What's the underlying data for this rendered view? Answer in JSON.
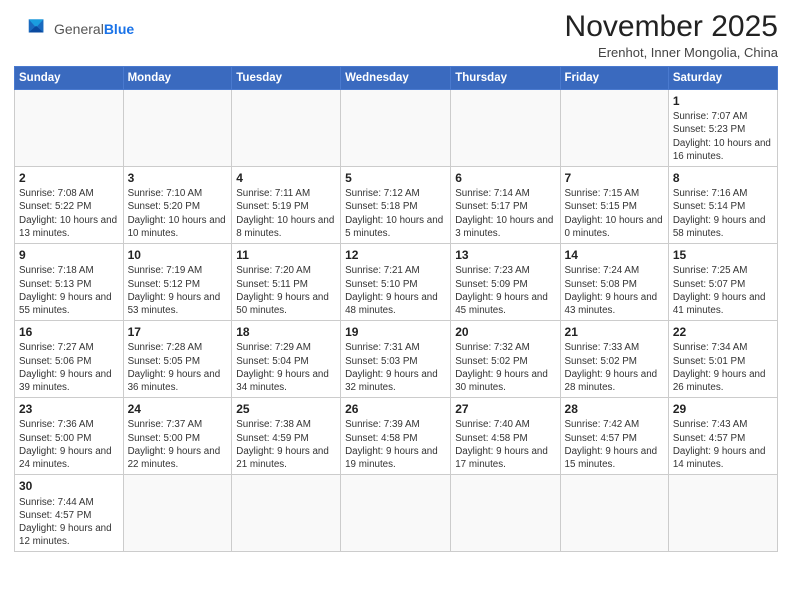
{
  "logo": {
    "general": "General",
    "blue": "Blue"
  },
  "header": {
    "month": "November 2025",
    "location": "Erenhot, Inner Mongolia, China"
  },
  "weekdays": [
    "Sunday",
    "Monday",
    "Tuesday",
    "Wednesday",
    "Thursday",
    "Friday",
    "Saturday"
  ],
  "weeks": [
    [
      {
        "day": "",
        "info": ""
      },
      {
        "day": "",
        "info": ""
      },
      {
        "day": "",
        "info": ""
      },
      {
        "day": "",
        "info": ""
      },
      {
        "day": "",
        "info": ""
      },
      {
        "day": "",
        "info": ""
      },
      {
        "day": "1",
        "info": "Sunrise: 7:07 AM\nSunset: 5:23 PM\nDaylight: 10 hours and 16 minutes."
      }
    ],
    [
      {
        "day": "2",
        "info": "Sunrise: 7:08 AM\nSunset: 5:22 PM\nDaylight: 10 hours and 13 minutes."
      },
      {
        "day": "3",
        "info": "Sunrise: 7:10 AM\nSunset: 5:20 PM\nDaylight: 10 hours and 10 minutes."
      },
      {
        "day": "4",
        "info": "Sunrise: 7:11 AM\nSunset: 5:19 PM\nDaylight: 10 hours and 8 minutes."
      },
      {
        "day": "5",
        "info": "Sunrise: 7:12 AM\nSunset: 5:18 PM\nDaylight: 10 hours and 5 minutes."
      },
      {
        "day": "6",
        "info": "Sunrise: 7:14 AM\nSunset: 5:17 PM\nDaylight: 10 hours and 3 minutes."
      },
      {
        "day": "7",
        "info": "Sunrise: 7:15 AM\nSunset: 5:15 PM\nDaylight: 10 hours and 0 minutes."
      },
      {
        "day": "8",
        "info": "Sunrise: 7:16 AM\nSunset: 5:14 PM\nDaylight: 9 hours and 58 minutes."
      }
    ],
    [
      {
        "day": "9",
        "info": "Sunrise: 7:18 AM\nSunset: 5:13 PM\nDaylight: 9 hours and 55 minutes."
      },
      {
        "day": "10",
        "info": "Sunrise: 7:19 AM\nSunset: 5:12 PM\nDaylight: 9 hours and 53 minutes."
      },
      {
        "day": "11",
        "info": "Sunrise: 7:20 AM\nSunset: 5:11 PM\nDaylight: 9 hours and 50 minutes."
      },
      {
        "day": "12",
        "info": "Sunrise: 7:21 AM\nSunset: 5:10 PM\nDaylight: 9 hours and 48 minutes."
      },
      {
        "day": "13",
        "info": "Sunrise: 7:23 AM\nSunset: 5:09 PM\nDaylight: 9 hours and 45 minutes."
      },
      {
        "day": "14",
        "info": "Sunrise: 7:24 AM\nSunset: 5:08 PM\nDaylight: 9 hours and 43 minutes."
      },
      {
        "day": "15",
        "info": "Sunrise: 7:25 AM\nSunset: 5:07 PM\nDaylight: 9 hours and 41 minutes."
      }
    ],
    [
      {
        "day": "16",
        "info": "Sunrise: 7:27 AM\nSunset: 5:06 PM\nDaylight: 9 hours and 39 minutes."
      },
      {
        "day": "17",
        "info": "Sunrise: 7:28 AM\nSunset: 5:05 PM\nDaylight: 9 hours and 36 minutes."
      },
      {
        "day": "18",
        "info": "Sunrise: 7:29 AM\nSunset: 5:04 PM\nDaylight: 9 hours and 34 minutes."
      },
      {
        "day": "19",
        "info": "Sunrise: 7:31 AM\nSunset: 5:03 PM\nDaylight: 9 hours and 32 minutes."
      },
      {
        "day": "20",
        "info": "Sunrise: 7:32 AM\nSunset: 5:02 PM\nDaylight: 9 hours and 30 minutes."
      },
      {
        "day": "21",
        "info": "Sunrise: 7:33 AM\nSunset: 5:02 PM\nDaylight: 9 hours and 28 minutes."
      },
      {
        "day": "22",
        "info": "Sunrise: 7:34 AM\nSunset: 5:01 PM\nDaylight: 9 hours and 26 minutes."
      }
    ],
    [
      {
        "day": "23",
        "info": "Sunrise: 7:36 AM\nSunset: 5:00 PM\nDaylight: 9 hours and 24 minutes."
      },
      {
        "day": "24",
        "info": "Sunrise: 7:37 AM\nSunset: 5:00 PM\nDaylight: 9 hours and 22 minutes."
      },
      {
        "day": "25",
        "info": "Sunrise: 7:38 AM\nSunset: 4:59 PM\nDaylight: 9 hours and 21 minutes."
      },
      {
        "day": "26",
        "info": "Sunrise: 7:39 AM\nSunset: 4:58 PM\nDaylight: 9 hours and 19 minutes."
      },
      {
        "day": "27",
        "info": "Sunrise: 7:40 AM\nSunset: 4:58 PM\nDaylight: 9 hours and 17 minutes."
      },
      {
        "day": "28",
        "info": "Sunrise: 7:42 AM\nSunset: 4:57 PM\nDaylight: 9 hours and 15 minutes."
      },
      {
        "day": "29",
        "info": "Sunrise: 7:43 AM\nSunset: 4:57 PM\nDaylight: 9 hours and 14 minutes."
      }
    ],
    [
      {
        "day": "30",
        "info": "Sunrise: 7:44 AM\nSunset: 4:57 PM\nDaylight: 9 hours and 12 minutes."
      },
      {
        "day": "",
        "info": ""
      },
      {
        "day": "",
        "info": ""
      },
      {
        "day": "",
        "info": ""
      },
      {
        "day": "",
        "info": ""
      },
      {
        "day": "",
        "info": ""
      },
      {
        "day": "",
        "info": ""
      }
    ]
  ]
}
